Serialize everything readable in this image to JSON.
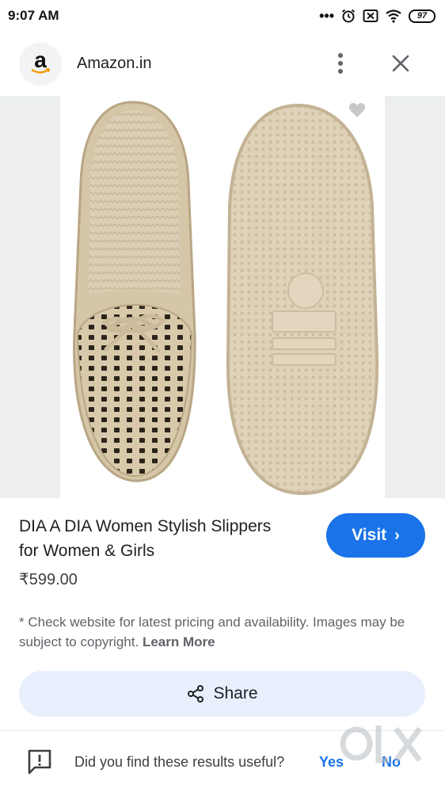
{
  "status_bar": {
    "time": "9:07 AM",
    "battery": "97"
  },
  "header": {
    "logo_letter": "a",
    "site_name": "Amazon.in"
  },
  "product": {
    "title": "DIA A DIA Women Stylish Slippers for Women & Girls",
    "price": "₹599.00",
    "visit_label": "Visit",
    "disclaimer": "* Check website for latest pricing and availability. Images may be subject to copyright.",
    "learn_more": "Learn More"
  },
  "share": {
    "label": "Share"
  },
  "feedback": {
    "question": "Did you find these results useful?",
    "yes": "Yes",
    "no": "No"
  },
  "icons": [
    "alarm-icon",
    "sim-icon",
    "wifi-icon",
    "battery-icon",
    "more-vert-icon",
    "close-icon",
    "heart-icon",
    "share-icon",
    "feedback-icon"
  ],
  "colors": {
    "accent": "#1a73e8",
    "share_bg": "#e8f0fe",
    "slipper": "#d9c9ad"
  }
}
